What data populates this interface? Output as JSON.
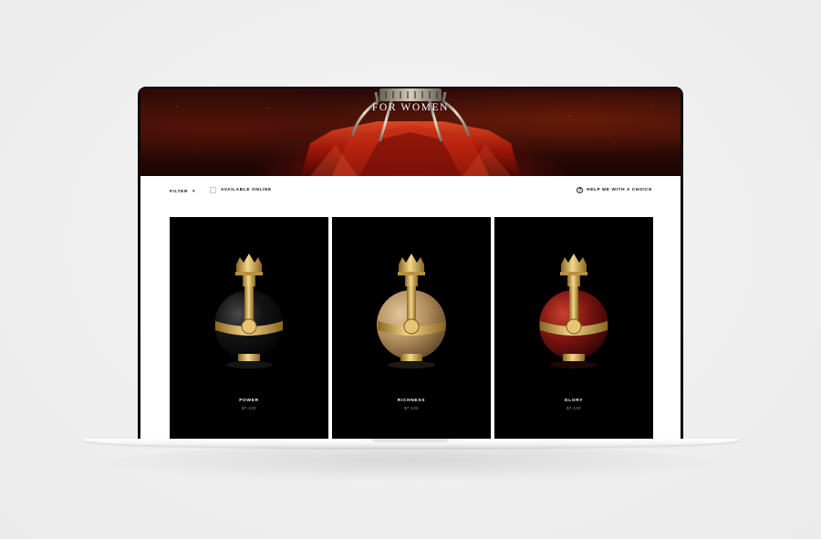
{
  "hero": {
    "title": "FOR WOMEN"
  },
  "toolbar": {
    "filter_label": "FILTER",
    "filter_chevron": "▾",
    "available_online_label": "AVAILABLE ONLINE",
    "available_online_checked": false,
    "help_icon_glyph": "?",
    "help_label": "HELP ME WITH A CHOICE"
  },
  "products": [
    {
      "name": "POWER",
      "price": "$7,100",
      "body_color": "#0c0c0c",
      "accent": "#d8b35a"
    },
    {
      "name": "RICHNESS",
      "price": "$7,100",
      "body_color": "#b38f5e",
      "accent": "#d8b35a"
    },
    {
      "name": "GLORY",
      "price": "$7,100",
      "body_color": "#7a1410",
      "accent": "#d8b35a"
    }
  ],
  "colors": {
    "page_background": "#efefef",
    "card_background": "#000000",
    "gold": "#d8b35a",
    "hero_red": "#8a1208"
  }
}
